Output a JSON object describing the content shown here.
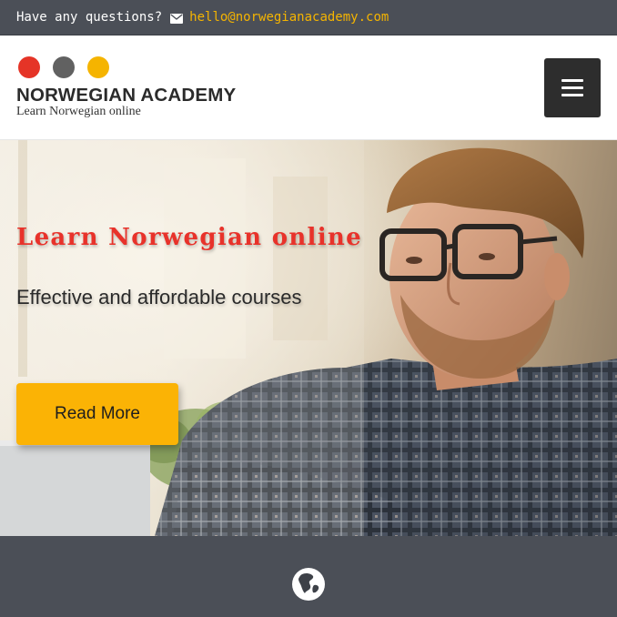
{
  "topbar": {
    "question": "Have any questions?",
    "email": "hello@norwegianacademy.com",
    "icon": "envelope-icon",
    "email_color": "#f5b400"
  },
  "header": {
    "brand": "NORWEGIAN ACADEMY",
    "tagline": "Learn Norwegian online",
    "logo_dot_colors": [
      "#e53427",
      "#616161",
      "#f5b400"
    ],
    "menu_icon": "hamburger-menu-icon"
  },
  "hero": {
    "title": "Learn Norwegian online",
    "subtitle": "Effective and affordable courses",
    "button_label": "Read More",
    "title_color": "#e8322a",
    "button_color": "#fbb305"
  },
  "band": {
    "icon": "globe-icon",
    "background": "#4b4f57"
  }
}
